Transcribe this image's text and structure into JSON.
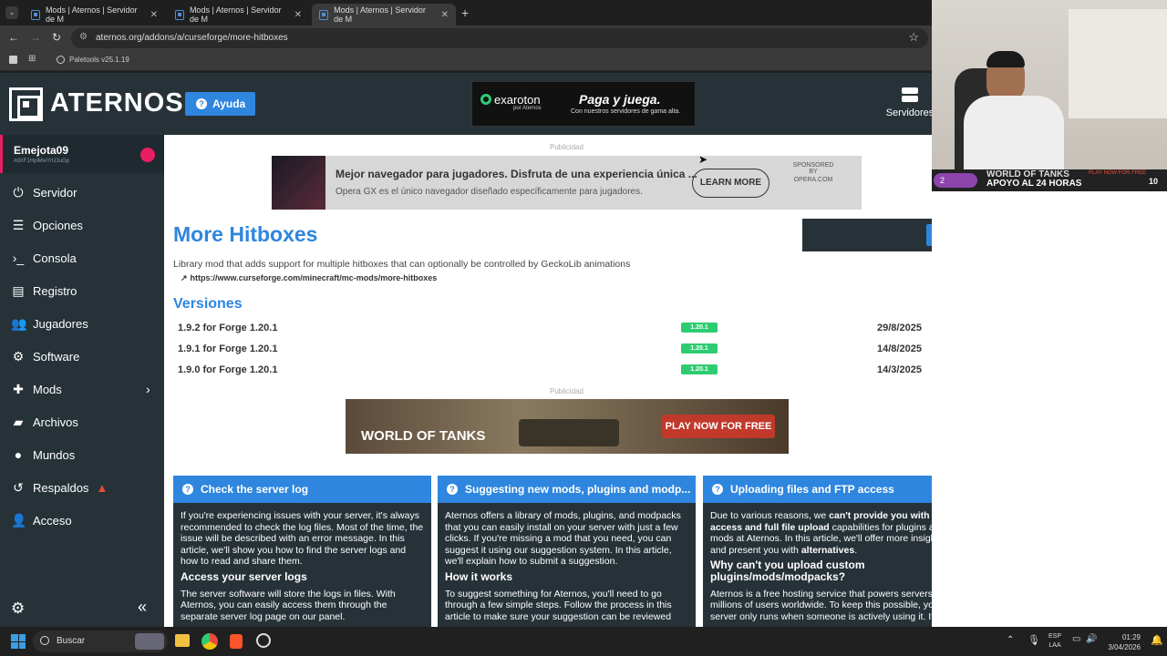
{
  "browser": {
    "tabs": [
      {
        "label": "Mods | Aternos | Servidor de M"
      },
      {
        "label": "Mods | Aternos | Servidor de M"
      },
      {
        "label": "Mods | Aternos | Servidor de M"
      }
    ],
    "url": "aternos.org/addons/a/curseforge/more-hitboxes",
    "bookmark": "Paletools v25.1.19"
  },
  "header": {
    "logo": "ATERNOS",
    "help": "Ayuda",
    "servers": "Servidores",
    "ad_brand": "exaroton",
    "ad_brand_sub": "por Aternos",
    "ad_title": "Paga y juega.",
    "ad_sub": "Con nuestros servidores de gama alta."
  },
  "sidebar": {
    "username": "Emejota09",
    "userid": "#dXF1HpiMwYrU3uGp",
    "items": [
      {
        "label": "Servidor",
        "icon": "power-icon"
      },
      {
        "label": "Opciones",
        "icon": "sliders-icon"
      },
      {
        "label": "Consola",
        "icon": "terminal-icon"
      },
      {
        "label": "Registro",
        "icon": "document-icon"
      },
      {
        "label": "Jugadores",
        "icon": "users-icon"
      },
      {
        "label": "Software",
        "icon": "cogs-icon"
      },
      {
        "label": "Mods",
        "icon": "puzzle-icon"
      },
      {
        "label": "Archivos",
        "icon": "folder-icon"
      },
      {
        "label": "Mundos",
        "icon": "globe-icon"
      },
      {
        "label": "Respaldos",
        "icon": "history-icon"
      },
      {
        "label": "Acceso",
        "icon": "user-icon"
      }
    ]
  },
  "content": {
    "ad_label": "Publicidad",
    "opera_ad": {
      "headline": "Mejor navegador para jugadores. Disfruta de una experiencia única ...",
      "sub": "Opera GX es el único navegador diseñado específicamente para jugadores.",
      "cta": "LEARN MORE",
      "sponsor_line1": "SPONSORED BY",
      "sponsor_line2": "OPERA.COM"
    },
    "title": "More Hitboxes",
    "description": "Library mod that adds support for multiple hitboxes that can optionally be controlled by GeckoLib animations",
    "link": "https://www.curseforge.com/minecraft/mc-mods/more-hitboxes",
    "versions_heading": "Versiones",
    "versions": [
      {
        "name": "1.9.2 for Forge 1.20.1",
        "mc": "1.20.1",
        "date": "29/8/2025"
      },
      {
        "name": "1.9.1 for Forge 1.20.1",
        "mc": "1.20.1",
        "date": "14/8/2025"
      },
      {
        "name": "1.9.0 for Forge 1.20.1",
        "mc": "1.20.1",
        "date": "14/3/2025"
      }
    ],
    "wot_ad": {
      "logo": "WORLD OF TANKS",
      "cta": "PLAY NOW FOR FREE"
    },
    "cards": [
      {
        "title": "Check the server log",
        "p1": "If you're experiencing issues with your server, it's always recommended to check the log files. Most of the time, the issue will be described with an error message. In this article, we'll show you how to find the server logs and how to read and share them.",
        "h": "Access your server logs",
        "p2": "The server software will store the logs in files. With Aternos, you can easily access them through the separate server log page on our panel."
      },
      {
        "title": "Suggesting new mods, plugins and modp...",
        "p1": "Aternos offers a library of mods, plugins, and modpacks that you can easily install on your server with just a few clicks. If you're missing a mod that you need, you can suggest it using our suggestion system. In this article, we'll explain how to submit a suggestion.",
        "h": "How it works",
        "p2": "To suggest something for Aternos, you'll need to go through a few simple steps.  Follow the process in this article to make sure your suggestion can be reviewed"
      },
      {
        "title": "Uploading files and FTP access",
        "p1a": "Due to various reasons, we ",
        "p1b": "can't provide you with FTP access and full file upload",
        "p1c": " capabilities for plugins and mods at Aternos. In this article, we'll offer more insights and present you with ",
        "p1d": "alternatives",
        "p1e": ".",
        "h": "Why can't you upload custom plugins/mods/modpacks?",
        "p2": "Aternos is a free hosting service that powers servers for millions of users worldwide. To keep this possible, your server only runs when someone is actively using it. If we"
      }
    ]
  },
  "stream_overlay": {
    "rank": "2",
    "title": "WORLD OF TANKS",
    "subtitle": "APOYO AL 24 HORAS",
    "badge": "PLAY NOW FOR FREE",
    "count": "10"
  },
  "taskbar": {
    "search": "Buscar",
    "lang1": "ESP",
    "lang2": "LAA",
    "time": "01:29",
    "date": "3/04/2026"
  }
}
